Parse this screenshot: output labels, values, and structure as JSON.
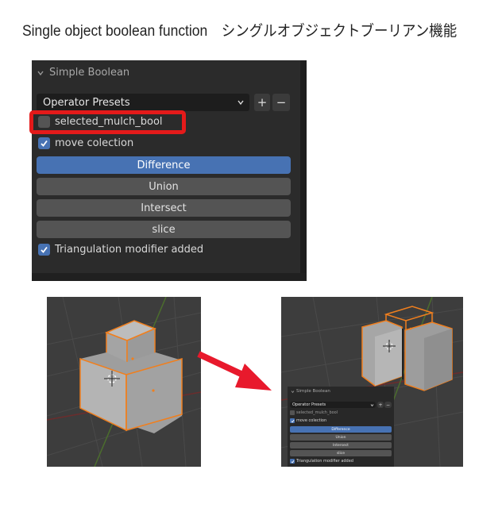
{
  "title": "Single object boolean function　シングルオブジェクトブーリアン機能",
  "panel": {
    "header": "Simple Boolean",
    "presets_label": "Operator Presets",
    "plus_label": "+",
    "minus_label": "−",
    "selected_label": "selected_mulch_bool",
    "selected_checked": false,
    "move_label": "move colection",
    "move_checked": true,
    "buttons": [
      "Difference",
      "Union",
      "Intersect",
      "slice"
    ],
    "active_button": "Difference",
    "triangulation_label": "Triangulation modifier added",
    "triangulation_checked": true
  },
  "colors": {
    "highlight_box": "#e41a1a",
    "arrow": "#e8192c",
    "active_button": "#4772b3",
    "selection_outline": "#f07f1e"
  },
  "icons": [
    "collapse-chevron-icon",
    "dropdown-chevron-icon",
    "checkmark-icon",
    "right-arrow-icon",
    "3d-cursor-icon"
  ]
}
